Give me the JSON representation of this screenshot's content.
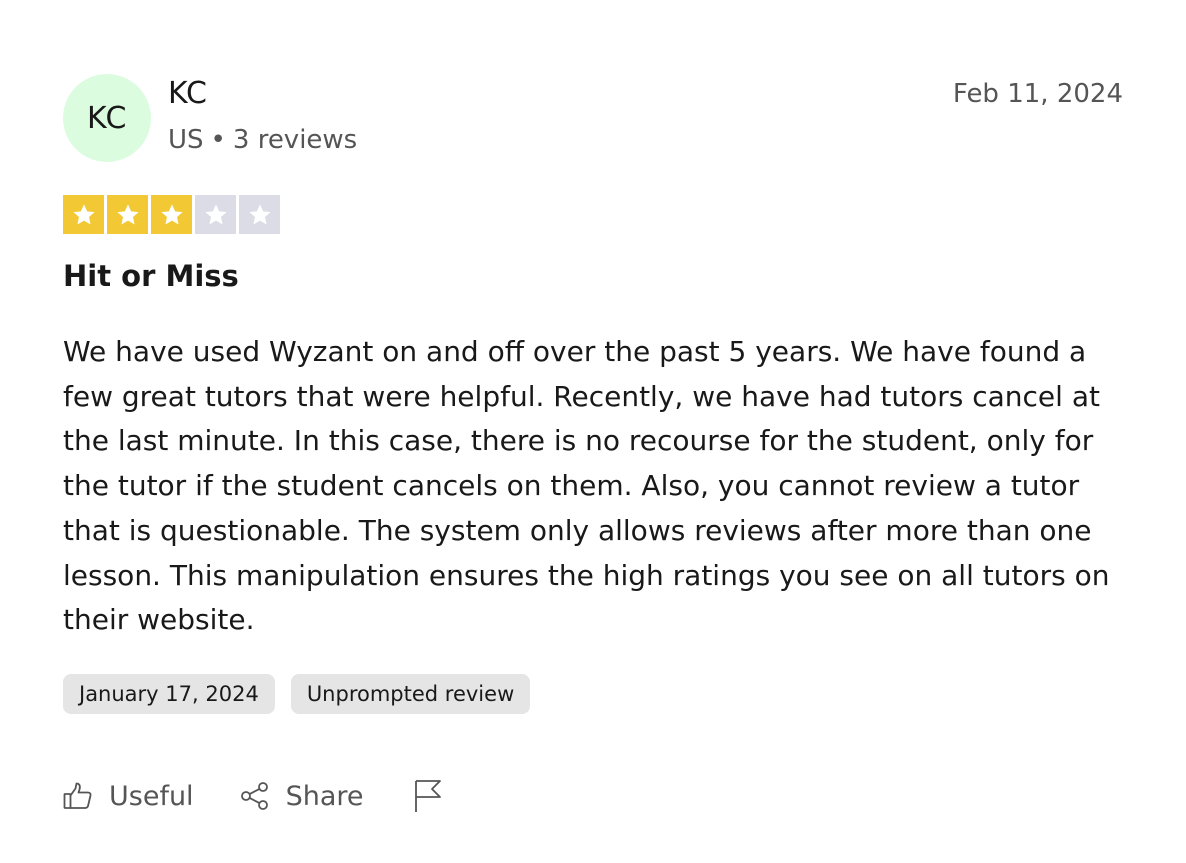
{
  "consumer": {
    "initials": "KC",
    "name": "KC",
    "country": "US",
    "separator": "•",
    "review_count": "3 reviews"
  },
  "review": {
    "date": "Feb 11, 2024",
    "rating": 3,
    "max_rating": 5,
    "title": "Hit or Miss",
    "text": "We have used Wyzant on and off over the past 5 years. We have found a few great tutors that were helpful. Recently, we have had tutors cancel at the last minute. In this case, there is no recourse for the student, only for the tutor if the student cancels on them. Also, you cannot review a tutor that is questionable. The system only allows reviews after more than one lesson. This manipulation ensures the high ratings you see on all tutors on their website.",
    "tags": [
      "January 17, 2024",
      "Unprompted review"
    ]
  },
  "actions": {
    "useful_label": "Useful",
    "share_label": "Share",
    "useful_icon": "thumbs-up-icon",
    "share_icon": "share-icon",
    "report_icon": "flag-icon"
  },
  "colors": {
    "avatar_bg": "#dcfce0",
    "star_filled": "#f2c934",
    "star_empty": "#dcdce6",
    "tag_bg": "#e5e5e5",
    "muted_text": "#555555"
  }
}
